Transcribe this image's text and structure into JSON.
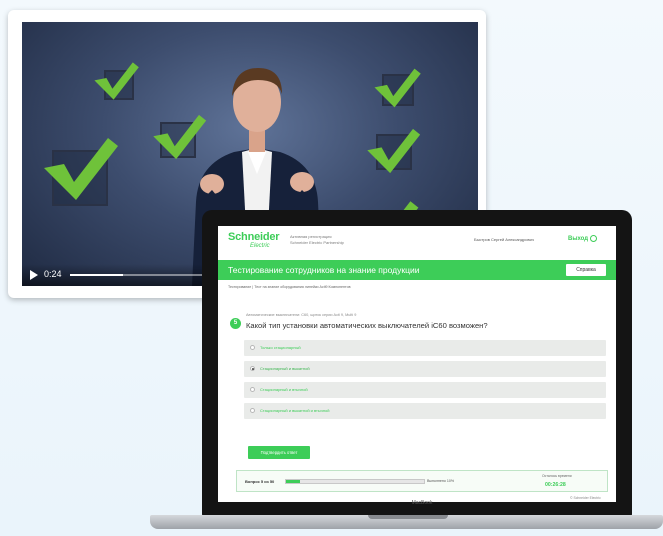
{
  "video": {
    "time": "0:24",
    "progress_percent": 35
  },
  "site": {
    "logo": {
      "name": "Schneider",
      "sub": "Electric"
    },
    "tagline": "Активная регистрация Schneider Electric Partnership",
    "user": "Быстров Сергей Александрович",
    "exit_label": "Выход",
    "title": "Тестирование сотрудников на знание продукции",
    "help_label": "Справка",
    "breadcrumb": "Тестирование | Тест на знание оборудования линейки Acti9 Компонентов"
  },
  "question": {
    "number": "5",
    "meta": "Автоматические выключатели: C60, щиток серии Acti 9, Multi 9",
    "text": "Какой тип установки автоматических выключателей iC60 возможен?",
    "options": [
      {
        "label": "Только стационарный",
        "selected": false
      },
      {
        "label": "Стационарный и выкатной",
        "selected": true
      },
      {
        "label": "Стационарный и втычной",
        "selected": false
      },
      {
        "label": "Стационарный и выкатной и втычной",
        "selected": false
      }
    ],
    "submit_label": "Подтвердить ответ"
  },
  "progress": {
    "label": "Вопрос 5 из 50",
    "fraction": 0.1,
    "right_label": "Выполнено 10%",
    "time_caption": "Осталось времени",
    "time_value": "00:26:28",
    "footer_link": "© Schneider Electric"
  },
  "laptop": {
    "brand": "MacBook"
  },
  "colors": {
    "brand_green": "#3dcd58",
    "video_bg": "#3d4d6e",
    "checkmark_green": "#6fc23a"
  }
}
